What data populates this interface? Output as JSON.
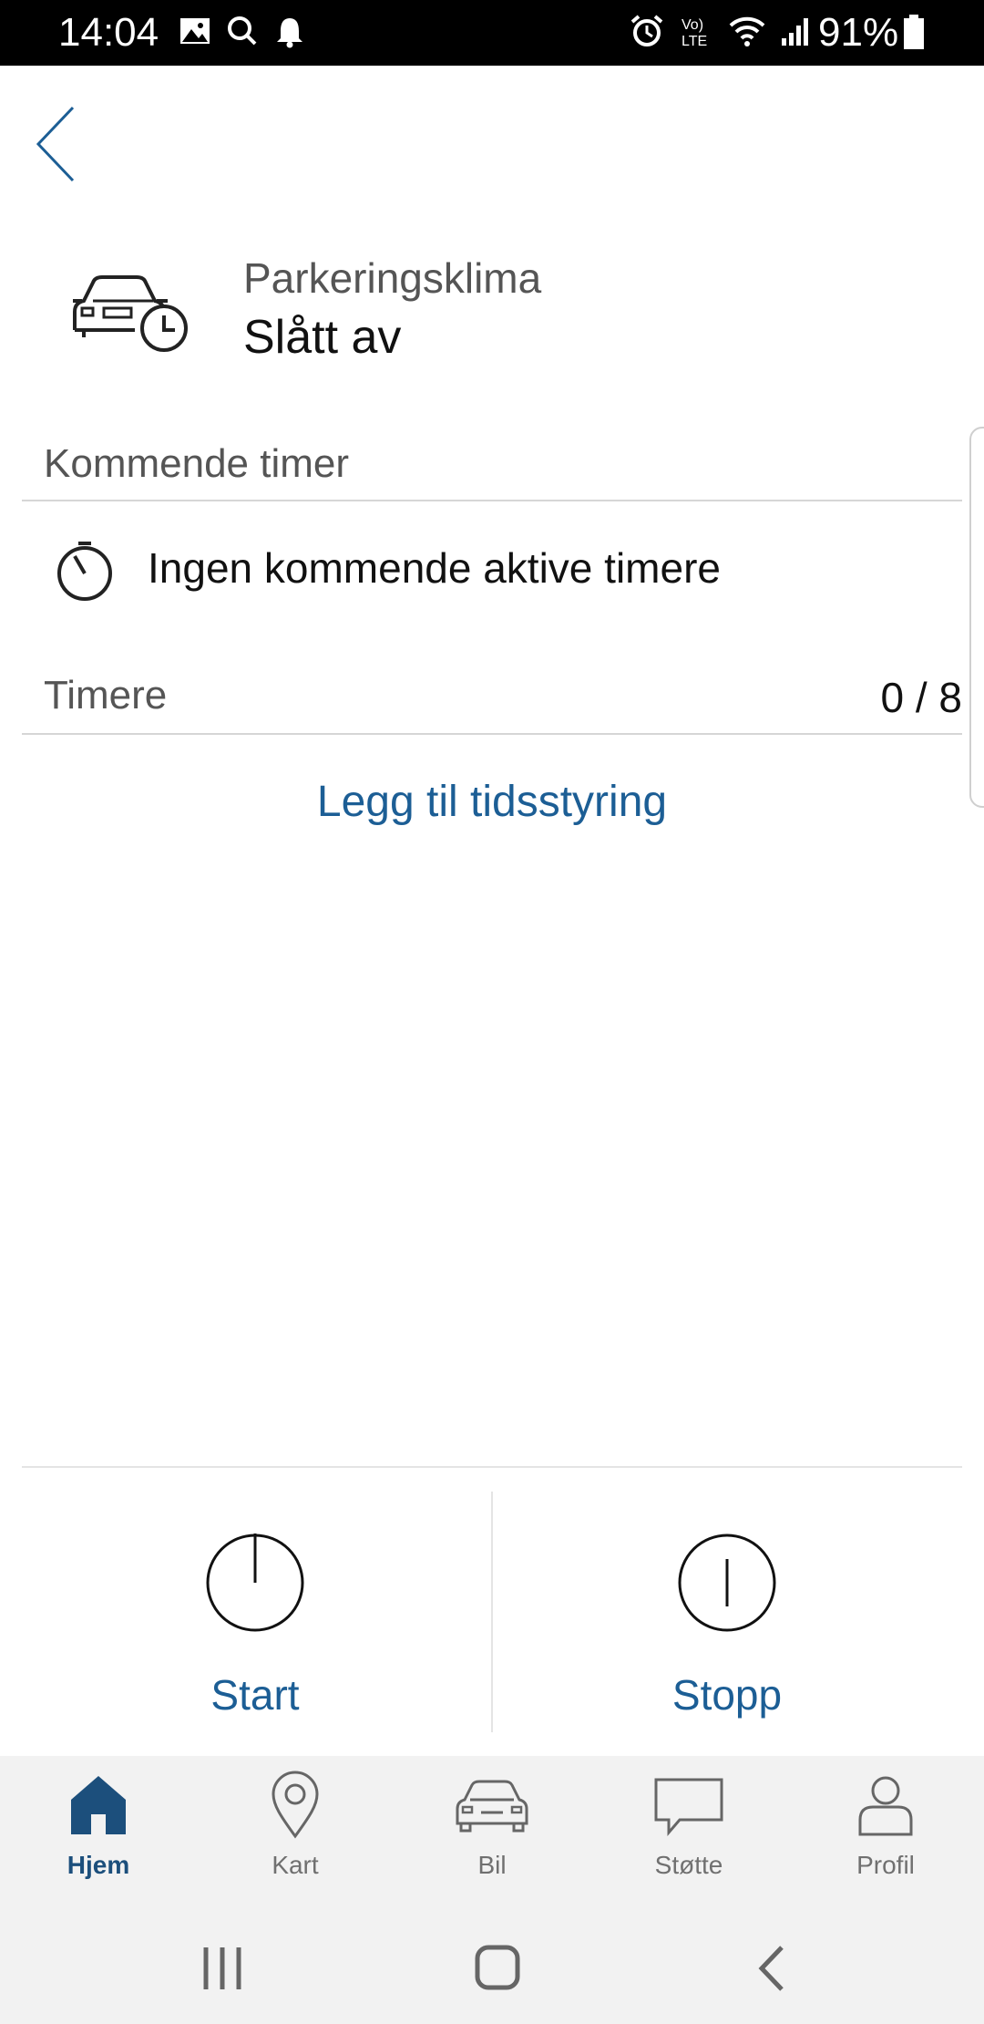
{
  "status_bar": {
    "time": "14:04",
    "battery": "91%"
  },
  "header": {
    "title": "Parkeringsklima",
    "status": "Slått av"
  },
  "upcoming": {
    "label": "Kommende timer",
    "empty_text": "Ingen kommende aktive timere"
  },
  "timers": {
    "label": "Timere",
    "count": "0 / 8"
  },
  "add_link": "Legg til tidsstyring",
  "actions": {
    "start": "Start",
    "stop": "Stopp"
  },
  "nav": {
    "items": [
      {
        "label": "Hjem",
        "icon": "home-icon"
      },
      {
        "label": "Kart",
        "icon": "map-pin-icon"
      },
      {
        "label": "Bil",
        "icon": "car-icon"
      },
      {
        "label": "Støtte",
        "icon": "chat-icon"
      },
      {
        "label": "Profil",
        "icon": "profile-icon"
      }
    ]
  },
  "colors": {
    "accent": "#1c5e95",
    "nav_active": "#1c4f7c"
  }
}
